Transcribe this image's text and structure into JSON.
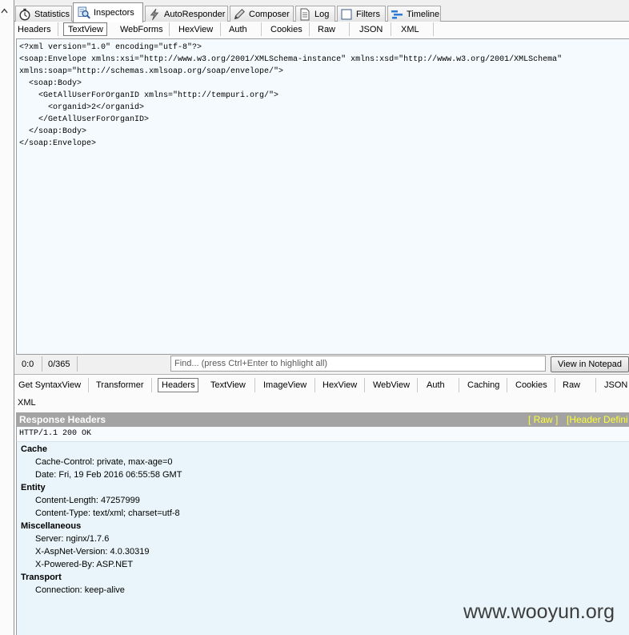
{
  "left_strip": {
    "icon": "chevron-up-icon"
  },
  "top_tabs": [
    {
      "label": "Statistics",
      "icon": "stopwatch-icon"
    },
    {
      "label": "Inspectors",
      "icon": "inspector-icon",
      "active": true
    },
    {
      "label": "AutoResponder",
      "icon": "lightning-icon"
    },
    {
      "label": "Composer",
      "icon": "pencil-icon"
    },
    {
      "label": "Log",
      "icon": "log-icon"
    },
    {
      "label": "Filters",
      "icon": "checkbox-icon"
    },
    {
      "label": "Timeline",
      "icon": "timeline-icon"
    }
  ],
  "request": {
    "tabs": [
      {
        "label": "Headers"
      },
      {
        "label": "TextView",
        "active": true
      },
      {
        "label": "WebForms"
      },
      {
        "label": "HexView"
      },
      {
        "label": "Auth"
      },
      {
        "label": "Cookies"
      },
      {
        "label": "Raw"
      },
      {
        "label": "JSON"
      },
      {
        "label": "XML"
      }
    ],
    "body_lines": [
      "<?xml version=\"1.0\" encoding=\"utf-8\"?>",
      "<soap:Envelope xmlns:xsi=\"http://www.w3.org/2001/XMLSchema-instance\" xmlns:xsd=\"http://www.w3.org/2001/XMLSchema\"",
      "xmlns:soap=\"http://schemas.xmlsoap.org/soap/envelope/\">",
      "  <soap:Body>",
      "    <GetAllUserForOrganID xmlns=\"http://tempuri.org/\">",
      "      <organid>2</organid>",
      "    </GetAllUserForOrganID>",
      "  </soap:Body>",
      "</soap:Envelope>"
    ],
    "status": {
      "caret": "0:0",
      "selection": "0/365",
      "find_placeholder": "Find... (press Ctrl+Enter to highlight all)",
      "notepad_button": "View in Notepad"
    }
  },
  "response": {
    "tabs": [
      {
        "label": "Get SyntaxView"
      },
      {
        "label": "Transformer"
      },
      {
        "label": "Headers",
        "active": true
      },
      {
        "label": "TextView"
      },
      {
        "label": "ImageView"
      },
      {
        "label": "HexView"
      },
      {
        "label": "WebView"
      },
      {
        "label": "Auth"
      },
      {
        "label": "Caching"
      },
      {
        "label": "Cookies"
      },
      {
        "label": "Raw"
      },
      {
        "label": "JSON"
      },
      {
        "label": "XML"
      }
    ],
    "headers_title": "Response Headers",
    "raw_link": "[ Raw ]",
    "definitions_link": "[Header Defini",
    "status_line": "HTTP/1.1 200 OK",
    "groups": [
      {
        "name": "Cache",
        "items": [
          "Cache-Control: private, max-age=0",
          "Date: Fri, 19 Feb 2016 06:55:58 GMT"
        ]
      },
      {
        "name": "Entity",
        "items": [
          "Content-Length: 47257999",
          "Content-Type: text/xml; charset=utf-8"
        ]
      },
      {
        "name": "Miscellaneous",
        "items": [
          "Server: nginx/1.7.6",
          "X-AspNet-Version: 4.0.30319",
          "X-Powered-By: ASP.NET"
        ]
      },
      {
        "name": "Transport",
        "items": [
          "Connection: keep-alive"
        ]
      }
    ]
  },
  "watermark": "www.wooyun.org",
  "colors": {
    "pane_background": "#f4fafd",
    "headers_background": "#e9f5fa",
    "header_bar": "#a3a3a3",
    "header_link": "#ffff33"
  }
}
